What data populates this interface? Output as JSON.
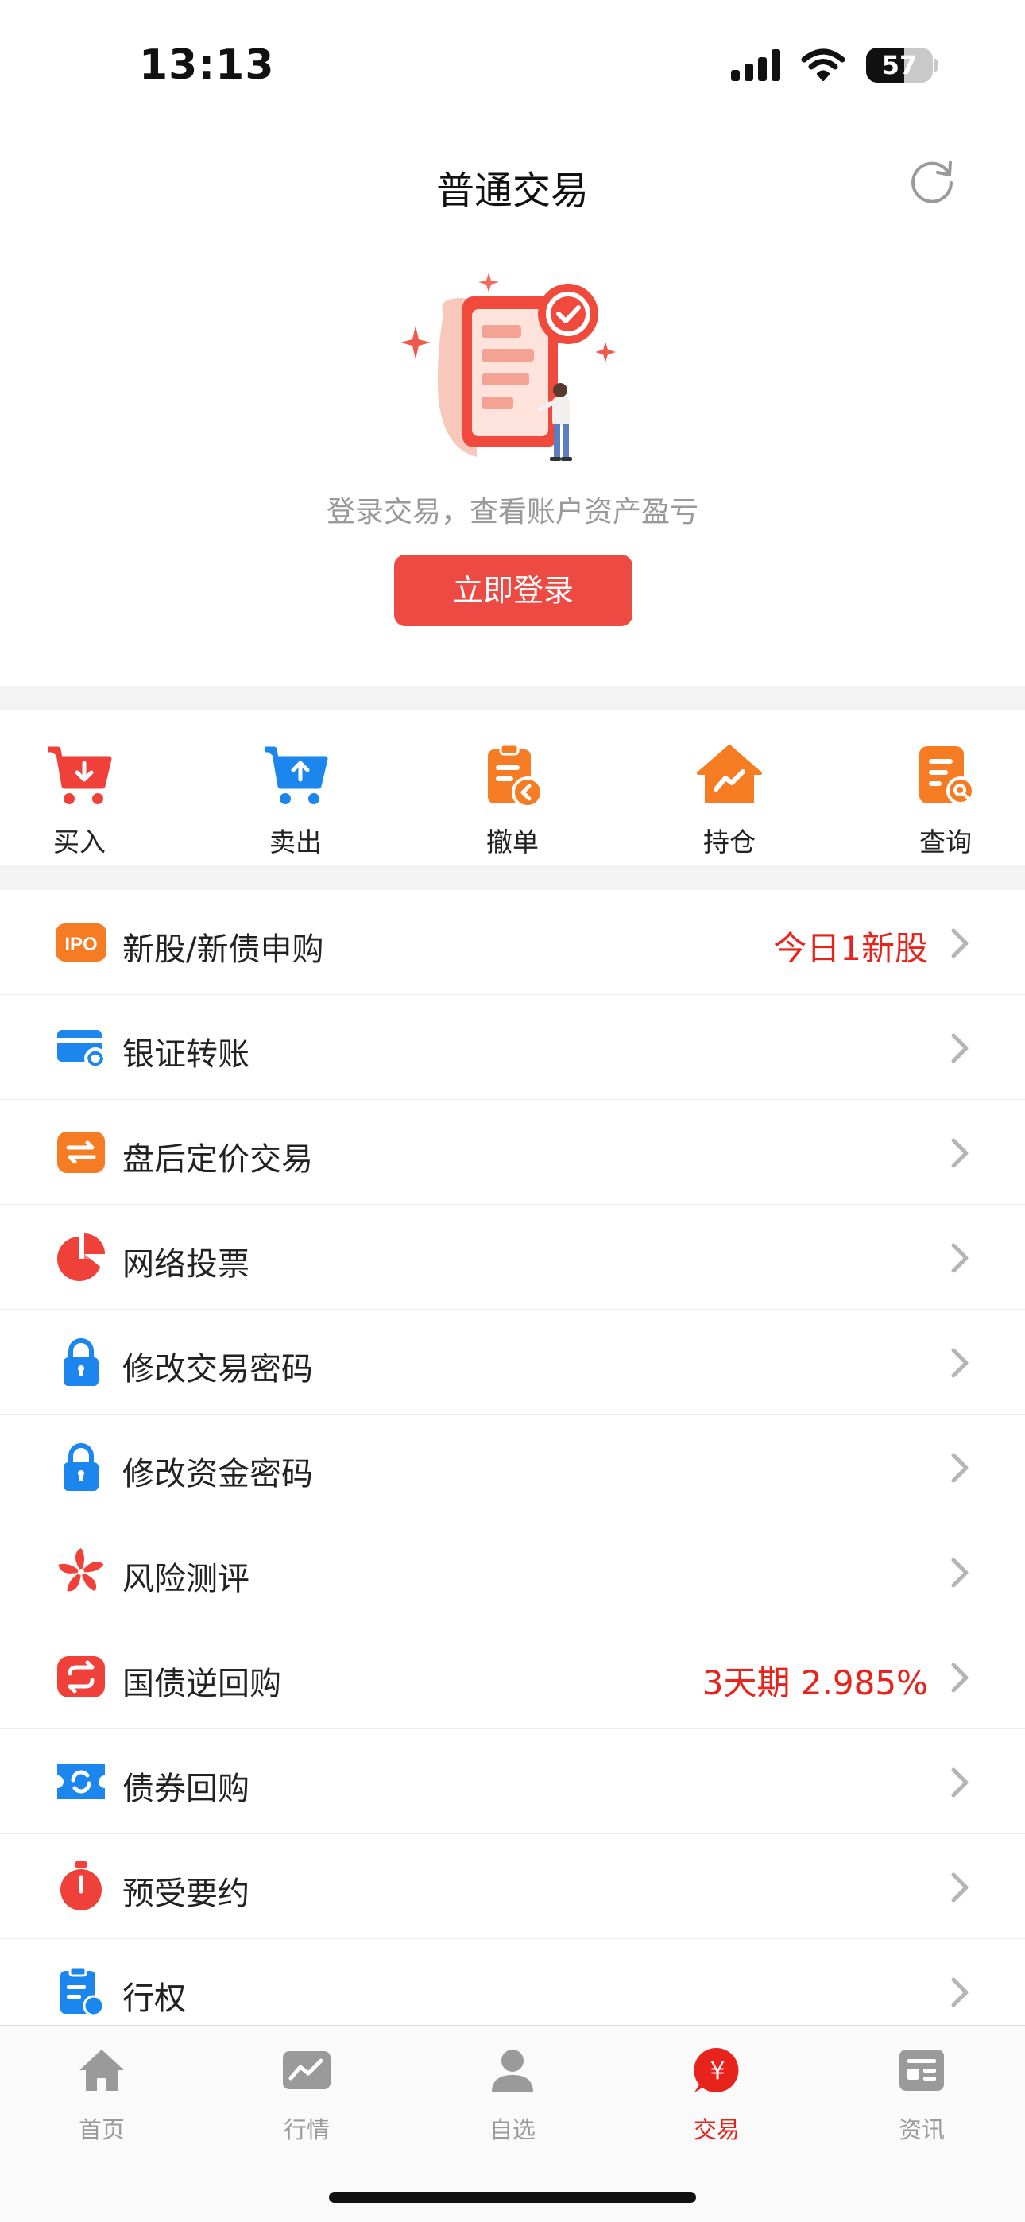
{
  "status_bar": {
    "time": "13:13",
    "battery": "57",
    "battery_level": 0.57
  },
  "header": {
    "title": "普通交易",
    "refresh_icon": "refresh-icon"
  },
  "login": {
    "tip": "登录交易，查看账户资产盈亏",
    "button": "立即登录"
  },
  "quick_actions": [
    {
      "label": "买入",
      "icon": "buy-cart-icon",
      "color": "#f0403a"
    },
    {
      "label": "卖出",
      "icon": "sell-cart-icon",
      "color": "#1a86ee"
    },
    {
      "label": "撤单",
      "icon": "cancel-order-icon",
      "color": "#f57c22"
    },
    {
      "label": "持仓",
      "icon": "holdings-icon",
      "color": "#f57c22"
    },
    {
      "label": "查询",
      "icon": "query-icon",
      "color": "#f57c22"
    }
  ],
  "menu": [
    {
      "label": "新股/新债申购",
      "extra": "今日1新股",
      "icon": "ipo-icon"
    },
    {
      "label": "银证转账",
      "extra": "",
      "icon": "bank-transfer-icon"
    },
    {
      "label": "盘后定价交易",
      "extra": "",
      "icon": "after-hours-icon"
    },
    {
      "label": "网络投票",
      "extra": "",
      "icon": "vote-pie-icon"
    },
    {
      "label": "修改交易密码",
      "extra": "",
      "icon": "lock-icon"
    },
    {
      "label": "修改资金密码",
      "extra": "",
      "icon": "lock-icon"
    },
    {
      "label": "风险测评",
      "extra": "",
      "icon": "bauhinia-icon"
    },
    {
      "label": "国债逆回购",
      "extra": "3天期 2.985%",
      "icon": "repo-icon"
    },
    {
      "label": "债券回购",
      "extra": "",
      "icon": "bond-repo-icon"
    },
    {
      "label": "预受要约",
      "extra": "",
      "icon": "stopwatch-icon"
    },
    {
      "label": "行权",
      "extra": "",
      "icon": "exercise-icon"
    }
  ],
  "tabs": [
    {
      "label": "首页",
      "icon": "home-icon",
      "active": false
    },
    {
      "label": "行情",
      "icon": "market-icon",
      "active": false
    },
    {
      "label": "自选",
      "icon": "user-icon",
      "active": false
    },
    {
      "label": "交易",
      "icon": "trade-icon",
      "active": true
    },
    {
      "label": "资讯",
      "icon": "news-icon",
      "active": false
    }
  ],
  "colors": {
    "accent": "#e8231b",
    "button": "#ee4a44",
    "blue": "#1a86ee",
    "orange": "#f57c22"
  }
}
